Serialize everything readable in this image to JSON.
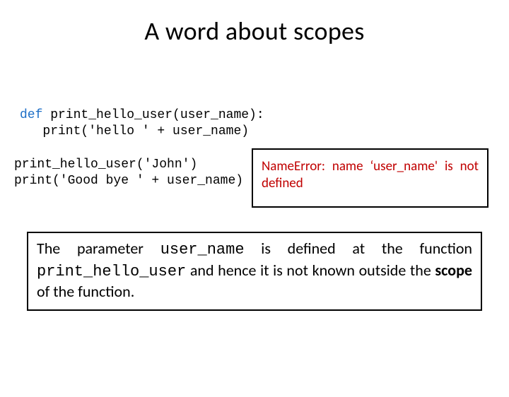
{
  "title": "A word about scopes",
  "code": {
    "def_kw": "def",
    "def_rest": " print_hello_user(user_name):",
    "def_body": "   print('hello ' + user_name)",
    "call1": "print_hello_user('John')",
    "call2": "print('Good bye ' + user_name)"
  },
  "error_text": "NameError: name ‘user_name' is not defined",
  "explain": {
    "t1": "The parameter ",
    "mono1": "user_name",
    "t2": " is defined at the function ",
    "mono2": "print_hello_user",
    "t3": " and hence it is not known outside the ",
    "bold": "scope",
    "t4": " of the function."
  }
}
